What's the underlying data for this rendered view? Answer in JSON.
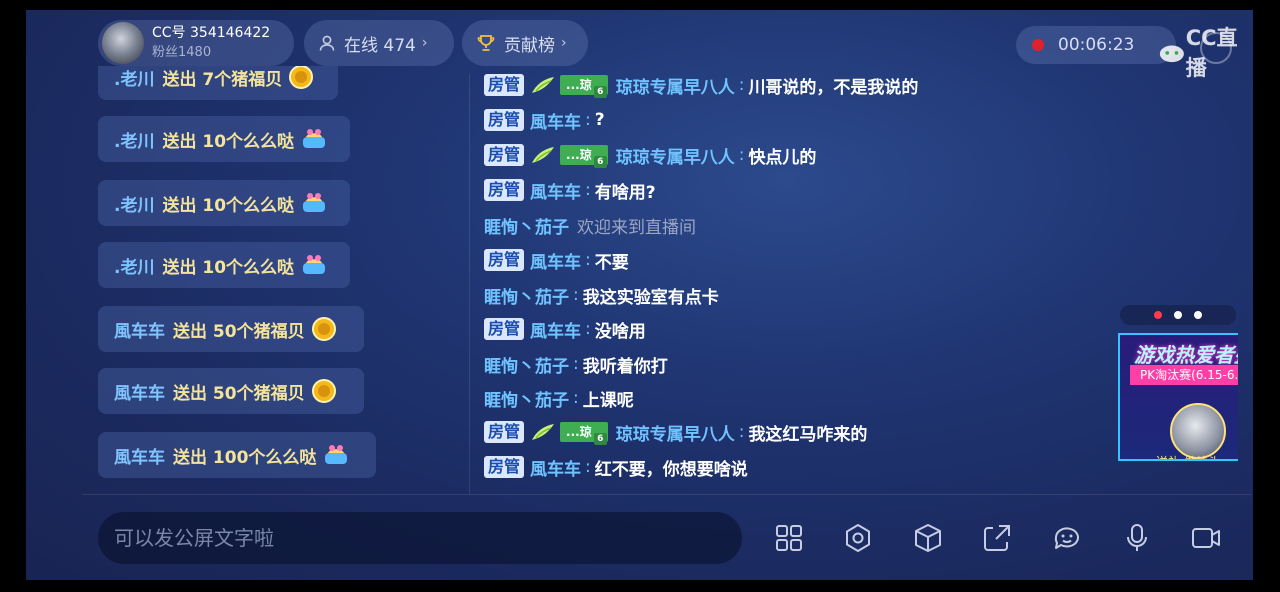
{
  "header": {
    "cc_label": "CC号 354146422",
    "fans_label": "粉丝1480",
    "online_label": "在线 474",
    "contrib_label": "贡献榜",
    "timer": "00:06:23",
    "watermark": "CC直播"
  },
  "gifts": [
    {
      "user": ".老川",
      "text": "送出 7个猪福贝",
      "icon": "coin-icon"
    },
    {
      "user": ".老川",
      "text": "送出 10个么么哒",
      "icon": "cake-icon"
    },
    {
      "user": ".老川",
      "text": "送出 10个么么哒",
      "icon": "cake-icon"
    },
    {
      "user": ".老川",
      "text": "送出 10个么么哒",
      "icon": "cake-icon"
    },
    {
      "user": "風车车",
      "text": "送出 50个猪福贝",
      "icon": "coin-icon"
    },
    {
      "user": "風车车",
      "text": "送出 50个猪福贝",
      "icon": "coin-icon"
    },
    {
      "user": "風车车",
      "text": "送出 100个么么哒",
      "icon": "cake-icon"
    }
  ],
  "chat": {
    "admin_badge": "房管",
    "fan_badge_name": "...琼",
    "fan_badge_level": "6",
    "separator": ":",
    "messages": [
      {
        "user": "琼琼专属早八人",
        "text": "川哥说的，不是我说的"
      },
      {
        "user": "風车车",
        "text": "?"
      },
      {
        "user": "琼琼专属早八人",
        "text": "快点儿的"
      },
      {
        "user": "風车车",
        "text": "有啥用?"
      },
      {
        "user": "睚恂丶茄子",
        "text": "欢迎来到直播间"
      },
      {
        "user": "風车车",
        "text": "不要"
      },
      {
        "user": "睚恂丶茄子",
        "text": "我这实验室有点卡"
      },
      {
        "user": "風车车",
        "text": "没啥用"
      },
      {
        "user": "睚恂丶茄子",
        "text": "我听着你打"
      },
      {
        "user": "睚恂丶茄子",
        "text": "上课呢"
      },
      {
        "user": "琼琼专属早八人",
        "text": "我这红马咋来的"
      },
      {
        "user": "風车车",
        "text": "红不要，你想要啥说"
      }
    ]
  },
  "promo": {
    "title": "游戏热爱者盛",
    "subtitle": "PK淘汰赛(6.15-6.",
    "bottom_text": "送礼 做续头"
  },
  "input": {
    "placeholder": "可以发公屏文字啦"
  },
  "toolbar": {
    "icons": [
      "apps-icon",
      "settings-icon",
      "box-icon",
      "share-icon",
      "emoji-icon",
      "mic-icon",
      "video-icon"
    ]
  },
  "colors": {
    "background": "#1f3471",
    "admin_badge_bg": "#dbe6ff",
    "username": "#6fc3ff",
    "gift_text": "#f4e39a",
    "record_dot": "#e0202c"
  }
}
